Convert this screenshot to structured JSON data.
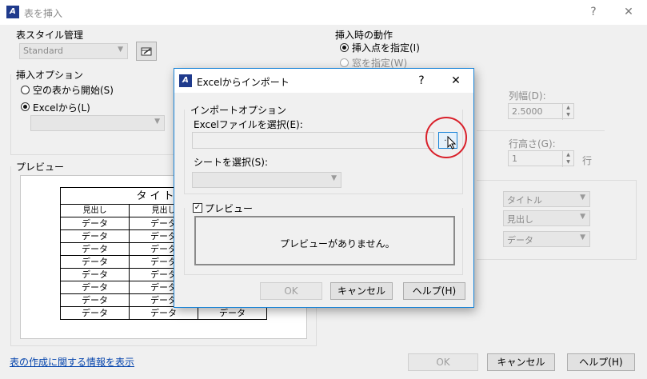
{
  "window": {
    "title": "表を挿入",
    "help": "?",
    "close": "✕"
  },
  "table_style": {
    "label": "表スタイル管理",
    "value": "Standard"
  },
  "insert_options": {
    "label": "挿入オプション",
    "empty_table": "空の表から開始(S)",
    "from_excel": "Excelから(L)"
  },
  "preview": {
    "label": "プレビュー",
    "title": "タイトル",
    "header": [
      "見出し",
      "見出し",
      ""
    ],
    "rows": [
      [
        "データ",
        "データ",
        ""
      ],
      [
        "データ",
        "データ",
        ""
      ],
      [
        "データ",
        "データ",
        ""
      ],
      [
        "データ",
        "データ",
        ""
      ],
      [
        "データ",
        "データ",
        ""
      ],
      [
        "データ",
        "データ",
        ""
      ],
      [
        "データ",
        "データ",
        ""
      ],
      [
        "データ",
        "データ",
        "データ"
      ]
    ]
  },
  "insert_behavior": {
    "label": "挿入時の動作",
    "insertion_point": "挿入点を指定(I)",
    "window": "窓を指定(W)"
  },
  "columns": {
    "width_label": "列幅(D):",
    "width_value": "2.5000"
  },
  "rows": {
    "height_label": "行高さ(G):",
    "height_value": "1",
    "unit": "行"
  },
  "cell_styles": [
    "タイトル",
    "見出し",
    "データ"
  ],
  "footer": {
    "link": "表の作成に関する情報を表示",
    "ok": "OK",
    "cancel": "キャンセル",
    "help": "ヘルプ(H)"
  },
  "dialog": {
    "title": "Excelからインポート",
    "help": "?",
    "close": "✕",
    "import_options": "インポートオプション",
    "file_label": "Excelファイルを選択(E):",
    "file_value": "",
    "browse": "...",
    "sheet_label": "シートを選択(S):",
    "preview_check": "✓",
    "preview_label": "プレビュー",
    "preview_message": "プレビューがありません。",
    "ok": "OK",
    "cancel": "キャンセル",
    "help_button": "ヘルプ(H)"
  },
  "colors": {
    "highlight_circle": "#d9202a",
    "dialog_border": "#1883d7",
    "link": "#0645ad"
  }
}
